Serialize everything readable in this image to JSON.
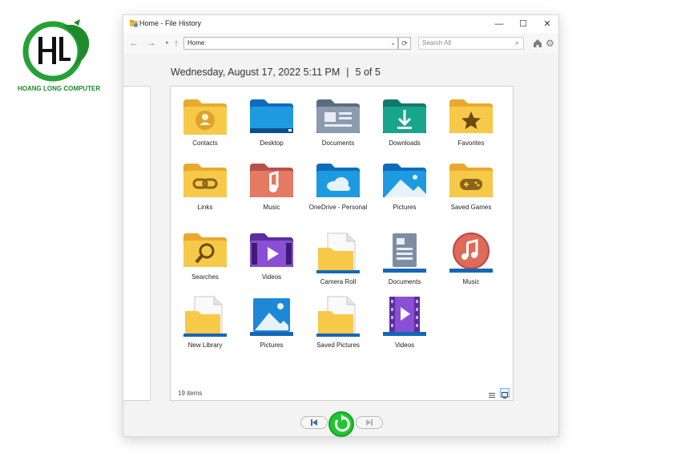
{
  "logo": {
    "text": "HOANG LONG COMPUTER",
    "monogram": "HL"
  },
  "window": {
    "title": "Home - File History",
    "controls": {
      "minimize": "—",
      "maximize": "☐",
      "close": "✕"
    }
  },
  "nav": {
    "address": "Home",
    "search_placeholder": "Search All"
  },
  "snapshot": {
    "date": "Wednesday, August 17, 2022 5:11 PM",
    "separator": "|",
    "position": "5 of 5"
  },
  "items": [
    {
      "label": "Contacts",
      "icon": "contacts-folder-icon"
    },
    {
      "label": "Desktop",
      "icon": "desktop-folder-icon"
    },
    {
      "label": "Documents",
      "icon": "documents-folder-icon"
    },
    {
      "label": "Downloads",
      "icon": "downloads-folder-icon"
    },
    {
      "label": "Favorites",
      "icon": "favorites-folder-icon"
    },
    {
      "label": "Links",
      "icon": "links-folder-icon"
    },
    {
      "label": "Music",
      "icon": "music-folder-icon"
    },
    {
      "label": "OneDrive - Personal",
      "icon": "onedrive-folder-icon"
    },
    {
      "label": "Pictures",
      "icon": "pictures-folder-icon"
    },
    {
      "label": "Saved Games",
      "icon": "saved-games-folder-icon"
    },
    {
      "label": "Searches",
      "icon": "searches-folder-icon"
    },
    {
      "label": "Videos",
      "icon": "videos-folder-icon"
    },
    {
      "label": "Camera Roll",
      "icon": "camera-roll-library-icon"
    },
    {
      "label": "Documents",
      "icon": "documents-library-icon"
    },
    {
      "label": "Music",
      "icon": "music-library-icon"
    },
    {
      "label": "New Library",
      "icon": "new-library-icon"
    },
    {
      "label": "Pictures",
      "icon": "pictures-library-icon"
    },
    {
      "label": "Saved Pictures",
      "icon": "saved-pictures-library-icon"
    },
    {
      "label": "Videos",
      "icon": "videos-library-icon"
    }
  ],
  "status": {
    "count": "19 items"
  },
  "colors": {
    "folder_yellow": "#f6c44a",
    "folder_blue": "#1e88d6",
    "accent_green": "#22c433",
    "restore_blue": "#3a6fa4"
  }
}
